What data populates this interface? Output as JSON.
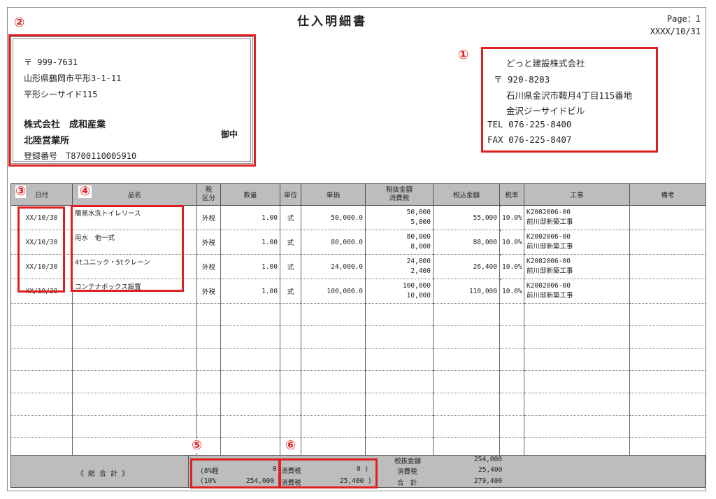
{
  "document": {
    "title": "仕入明細書",
    "page": "Page：1",
    "date": "XXXX/10/31"
  },
  "markers": {
    "m1": "①",
    "m2": "②",
    "m3": "③",
    "m4": "④",
    "m5": "⑤",
    "m6": "⑥"
  },
  "supplier": {
    "postal": "〒 999-7631",
    "address1": "山形県鶴岡市平形3-1-11",
    "address2": "平形シーサイド115",
    "company": "株式会社　成和産業",
    "branch": "北陸営業所",
    "honorific": "御中",
    "registration": "登録番号　T8700110005910"
  },
  "buyer": {
    "company": "どっと建設株式会社",
    "postal": "〒 920-8203",
    "address1": "石川県金沢市鞍月4丁目115番地",
    "address2": "金沢ジーサイドビル",
    "tel": "TEL 076-225-8400",
    "fax": "FAX 076-225-8407"
  },
  "table": {
    "headers": {
      "date": "日付",
      "item": "品名",
      "tax_type": "税\n区分",
      "qty": "数量",
      "unit": "単位",
      "price": "単価",
      "amount_excl": "税抜金額\n消費税",
      "amount_incl": "税込金額",
      "tax_rate": "税率",
      "project": "工事",
      "remarks": "備考"
    },
    "rows": [
      {
        "date": "XX/10/30",
        "item": "簡易水洗トイレリース",
        "tax_type": "外税",
        "qty": "1.00",
        "unit": "式",
        "price": "50,000.0",
        "excl": "50,000",
        "tax": "5,000",
        "incl": "55,000",
        "rate": "10.0%",
        "project_code": "K2002006-00",
        "project_name": "前川邸新築工事"
      },
      {
        "date": "XX/10/30",
        "item": "用水　他一式",
        "tax_type": "外税",
        "qty": "1.00",
        "unit": "式",
        "price": "80,000.0",
        "excl": "80,000",
        "tax": "8,000",
        "incl": "88,000",
        "rate": "10.0%",
        "project_code": "K2002006-00",
        "project_name": "前川邸新築工事"
      },
      {
        "date": "XX/10/30",
        "item": "4tユニック・5tクレーン",
        "tax_type": "外税",
        "qty": "1.00",
        "unit": "式",
        "price": "24,000.0",
        "excl": "24,000",
        "tax": "2,400",
        "incl": "26,400",
        "rate": "10.0%",
        "project_code": "K2002006-00",
        "project_name": "前川邸新築工事"
      },
      {
        "date": "XX/10/30",
        "item": "コンテナボックス設置",
        "tax_type": "外税",
        "qty": "1.00",
        "unit": "式",
        "price": "100,000.0",
        "excl": "100,000",
        "tax": "10,000",
        "incl": "110,000",
        "rate": "10.0%",
        "project_code": "K2002006-00",
        "project_name": "前川邸新築工事"
      }
    ]
  },
  "totals": {
    "label": "《 総 合 計 》",
    "r8_label": "(8%軽",
    "r8_amount": "0",
    "r8_tax_label": "消費税",
    "r8_tax": "0 )",
    "r10_label": "(10%",
    "r10_amount": "254,000",
    "r10_tax_label": "消費税",
    "r10_tax": "25,400 )",
    "excl_label": "税抜金額",
    "excl_value": "254,000",
    "tax_label": "消費税",
    "tax_value": "25,400",
    "total_label": "合　計",
    "total_value": "279,400"
  },
  "colors": {
    "marker_red": "#e02020",
    "header_gray": "#bdbdbd",
    "tick_green": "#2a8a2a"
  }
}
